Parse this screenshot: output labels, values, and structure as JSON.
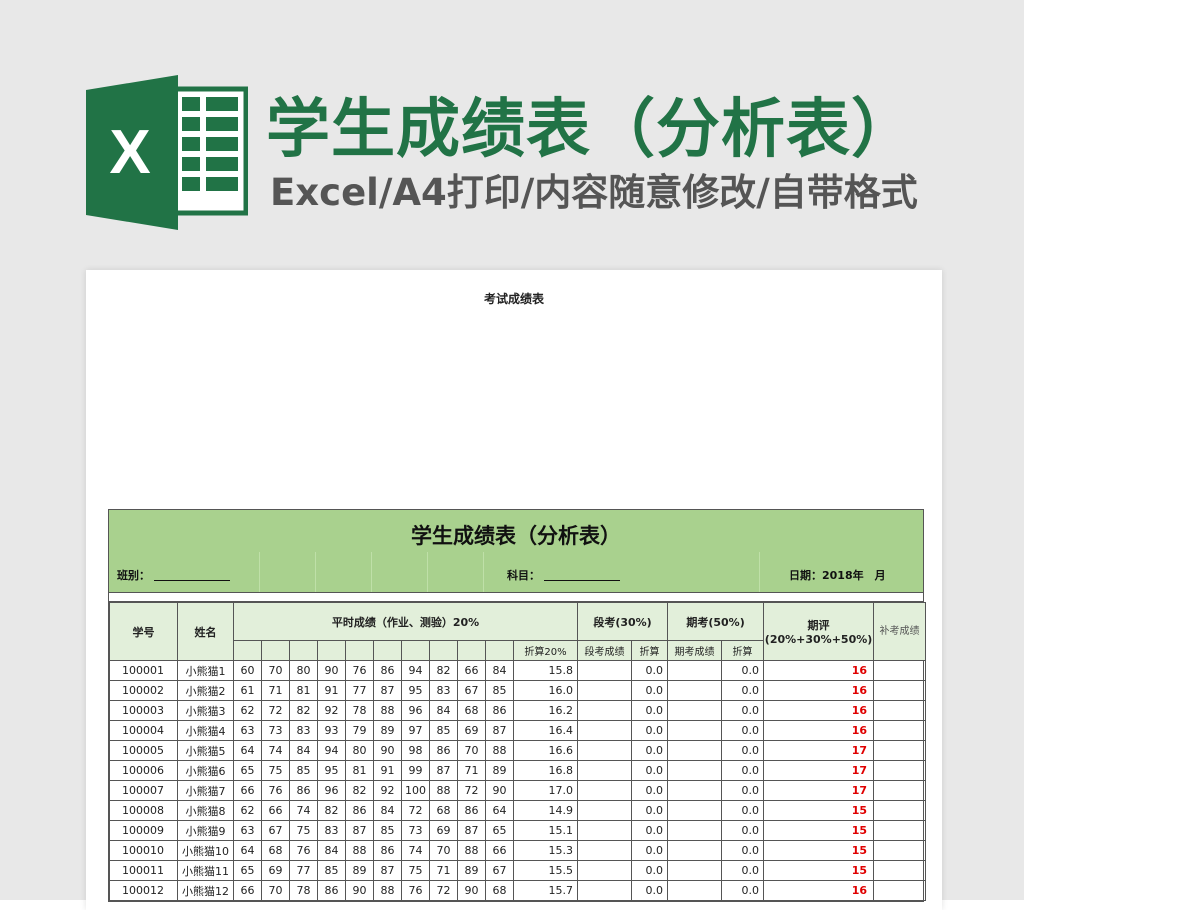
{
  "banner": {
    "title": "学生成绩表（分析表）",
    "subtitle": "Excel/A4打印/内容随意修改/自带格式",
    "logo_letter": "X"
  },
  "colors": {
    "brand": "#217346",
    "header_fill": "#a9d18e",
    "subheader_fill": "#e2efda",
    "final_score": "#e00000"
  },
  "paper": {
    "title": "考试成绩表"
  },
  "sheet": {
    "title": "学生成绩表（分析表）",
    "class_label": "班别：",
    "subject_label": "科目：",
    "date_label": "日期：2018年　月"
  },
  "table": {
    "headers": {
      "student_id": "学号",
      "name": "姓名",
      "regular": "平时成绩（作业、测验）20%",
      "regular_convert": "折算20%",
      "midterm": "段考(30%)",
      "midterm_score": "段考成绩",
      "midterm_convert": "折算",
      "final": "期考(50%)",
      "final_score": "期考成绩",
      "final_convert": "折算",
      "overall": "期评",
      "overall_formula": "(20%+30%+50%)",
      "makeup": "补考成绩"
    },
    "rows": [
      {
        "id": "100001",
        "name": "小熊猫1",
        "scores": [
          "60",
          "70",
          "80",
          "90",
          "76",
          "86",
          "94",
          "82",
          "66",
          "84"
        ],
        "conv20": "15.8",
        "mid": "",
        "mid_conv": "0.0",
        "fin": "",
        "fin_conv": "0.0",
        "overall": "16",
        "makeup": ""
      },
      {
        "id": "100002",
        "name": "小熊猫2",
        "scores": [
          "61",
          "71",
          "81",
          "91",
          "77",
          "87",
          "95",
          "83",
          "67",
          "85"
        ],
        "conv20": "16.0",
        "mid": "",
        "mid_conv": "0.0",
        "fin": "",
        "fin_conv": "0.0",
        "overall": "16",
        "makeup": ""
      },
      {
        "id": "100003",
        "name": "小熊猫3",
        "scores": [
          "62",
          "72",
          "82",
          "92",
          "78",
          "88",
          "96",
          "84",
          "68",
          "86"
        ],
        "conv20": "16.2",
        "mid": "",
        "mid_conv": "0.0",
        "fin": "",
        "fin_conv": "0.0",
        "overall": "16",
        "makeup": ""
      },
      {
        "id": "100004",
        "name": "小熊猫4",
        "scores": [
          "63",
          "73",
          "83",
          "93",
          "79",
          "89",
          "97",
          "85",
          "69",
          "87"
        ],
        "conv20": "16.4",
        "mid": "",
        "mid_conv": "0.0",
        "fin": "",
        "fin_conv": "0.0",
        "overall": "16",
        "makeup": ""
      },
      {
        "id": "100005",
        "name": "小熊猫5",
        "scores": [
          "64",
          "74",
          "84",
          "94",
          "80",
          "90",
          "98",
          "86",
          "70",
          "88"
        ],
        "conv20": "16.6",
        "mid": "",
        "mid_conv": "0.0",
        "fin": "",
        "fin_conv": "0.0",
        "overall": "17",
        "makeup": ""
      },
      {
        "id": "100006",
        "name": "小熊猫6",
        "scores": [
          "65",
          "75",
          "85",
          "95",
          "81",
          "91",
          "99",
          "87",
          "71",
          "89"
        ],
        "conv20": "16.8",
        "mid": "",
        "mid_conv": "0.0",
        "fin": "",
        "fin_conv": "0.0",
        "overall": "17",
        "makeup": ""
      },
      {
        "id": "100007",
        "name": "小熊猫7",
        "scores": [
          "66",
          "76",
          "86",
          "96",
          "82",
          "92",
          "100",
          "88",
          "72",
          "90"
        ],
        "conv20": "17.0",
        "mid": "",
        "mid_conv": "0.0",
        "fin": "",
        "fin_conv": "0.0",
        "overall": "17",
        "makeup": ""
      },
      {
        "id": "100008",
        "name": "小熊猫8",
        "scores": [
          "62",
          "66",
          "74",
          "82",
          "86",
          "84",
          "72",
          "68",
          "86",
          "64"
        ],
        "conv20": "14.9",
        "mid": "",
        "mid_conv": "0.0",
        "fin": "",
        "fin_conv": "0.0",
        "overall": "15",
        "makeup": ""
      },
      {
        "id": "100009",
        "name": "小熊猫9",
        "scores": [
          "63",
          "67",
          "75",
          "83",
          "87",
          "85",
          "73",
          "69",
          "87",
          "65"
        ],
        "conv20": "15.1",
        "mid": "",
        "mid_conv": "0.0",
        "fin": "",
        "fin_conv": "0.0",
        "overall": "15",
        "makeup": ""
      },
      {
        "id": "100010",
        "name": "小熊猫10",
        "scores": [
          "64",
          "68",
          "76",
          "84",
          "88",
          "86",
          "74",
          "70",
          "88",
          "66"
        ],
        "conv20": "15.3",
        "mid": "",
        "mid_conv": "0.0",
        "fin": "",
        "fin_conv": "0.0",
        "overall": "15",
        "makeup": ""
      },
      {
        "id": "100011",
        "name": "小熊猫11",
        "scores": [
          "65",
          "69",
          "77",
          "85",
          "89",
          "87",
          "75",
          "71",
          "89",
          "67"
        ],
        "conv20": "15.5",
        "mid": "",
        "mid_conv": "0.0",
        "fin": "",
        "fin_conv": "0.0",
        "overall": "15",
        "makeup": ""
      },
      {
        "id": "100012",
        "name": "小熊猫12",
        "scores": [
          "66",
          "70",
          "78",
          "86",
          "90",
          "88",
          "76",
          "72",
          "90",
          "68"
        ],
        "conv20": "15.7",
        "mid": "",
        "mid_conv": "0.0",
        "fin": "",
        "fin_conv": "0.0",
        "overall": "16",
        "makeup": ""
      }
    ]
  }
}
